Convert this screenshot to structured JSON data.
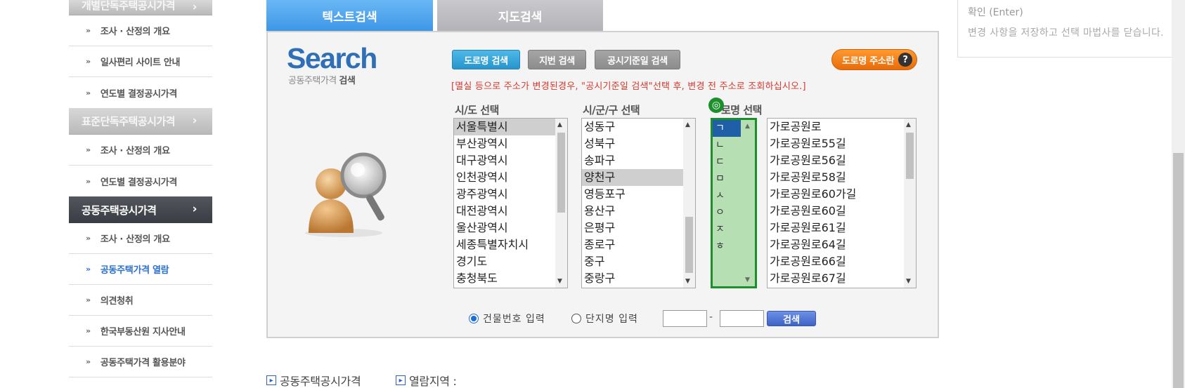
{
  "sidebar": {
    "top_header": "개별단독주택공시가격",
    "group1_items": [
      "조사 · 산정의 개요",
      "일사편리 사이트 안내",
      "연도별 결정공시가격"
    ],
    "group2_header": "표준단독주택공시가격",
    "group2_items": [
      "조사 · 산정의 개요",
      "연도별 결정공시가격"
    ],
    "group3_header": "공동주택공시가격",
    "group3_items": [
      "조사 · 산정의 개요",
      "공동주택가격 열람",
      "의견청취",
      "한국부동산원 지사안내",
      "공동주택가격 활용분야"
    ],
    "chevron": "›"
  },
  "tabs": {
    "text_search": "텍스트검색",
    "map_search": "지도검색"
  },
  "logo": {
    "word": "Search",
    "sub_prefix": "공동주택가격",
    "sub_bold": "검색"
  },
  "buttons": {
    "road_search": "도로명 검색",
    "jibun_search": "지번 검색",
    "date_search": "공시기준일 검색",
    "road_info": "도로명 주소란",
    "help": "?"
  },
  "notice": "[멸실 등으로 주소가 변경된경우, \"공시기준일 검색\"선택 후, 변경 전 주소로 조회하십시오.]",
  "columns": {
    "sido_label": "시/도 선택",
    "sigungu_label": "시/군/구 선택",
    "road_label": "로명 선택"
  },
  "lists": {
    "sido": [
      "서울특별시",
      "부산광역시",
      "대구광역시",
      "인천광역시",
      "광주광역시",
      "대전광역시",
      "울산광역시",
      "세종특별자치시",
      "경기도",
      "충청북도"
    ],
    "sido_selected": "서울특별시",
    "sigungu": [
      "성동구",
      "성북구",
      "송파구",
      "양천구",
      "영등포구",
      "용산구",
      "은평구",
      "종로구",
      "중구",
      "중랑구"
    ],
    "sigungu_selected": "양천구",
    "initials": [
      "ㄱ",
      "ㄴ",
      "ㄷ",
      "ㅁ",
      "ㅅ",
      "ㅇ",
      "ㅈ",
      "ㅎ"
    ],
    "initial_selected": "ㄱ",
    "roads": [
      "가로공원로",
      "가로공원로55길",
      "가로공원로56길",
      "가로공원로58길",
      "가로공원로60가길",
      "가로공원로60길",
      "가로공원로61길",
      "가로공원로64길",
      "가로공원로66길",
      "가로공원로67길"
    ]
  },
  "form": {
    "radio_building": "건물번호 입력",
    "radio_complex": "단지명 입력",
    "selected_radio": "건물번호 입력",
    "num1": "",
    "num2": "",
    "dash": "-",
    "submit": "검색"
  },
  "breadcrumb": {
    "item1": "공동주택공시가격",
    "item2": "열람지역 :"
  },
  "tooltip": {
    "title": "확인 (Enter)",
    "body": "변경 사항을 저장하고 선택 마법사를 닫습니다."
  },
  "colors": {
    "tab_active": "#4aa3ef",
    "road_button": "#2f9fd6",
    "road_info_button": "#f07b16",
    "notice_red": "#d8392f",
    "highlight_green": "#1a8f2c",
    "selected_blue": "#1e5fa8",
    "sidebar_active": "#2b6fd0"
  }
}
